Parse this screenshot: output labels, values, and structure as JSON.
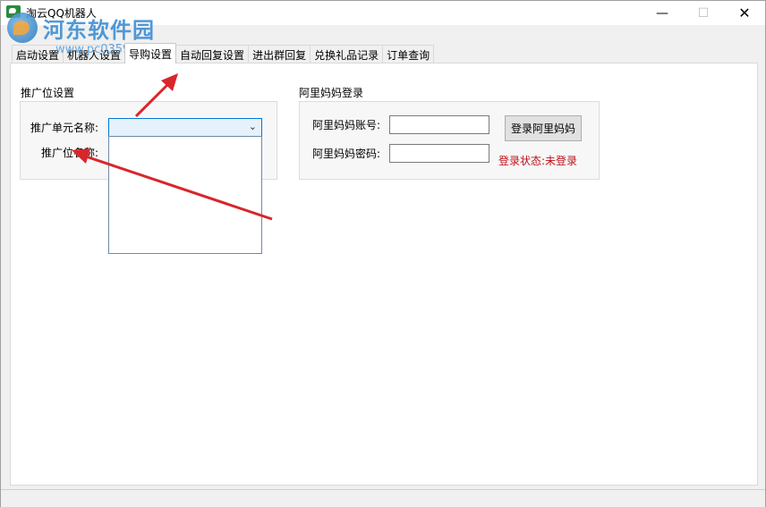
{
  "window": {
    "title": "淘云QQ机器人",
    "minimize_label": "—",
    "maximize_label": "☐",
    "close_label": "✕"
  },
  "watermark": {
    "site_name": "河东软件园",
    "url": "www.pc0359.cn"
  },
  "tabs": [
    {
      "label": "启动设置",
      "active": false
    },
    {
      "label": "机器人设置",
      "active": false
    },
    {
      "label": "导购设置",
      "active": true
    },
    {
      "label": "自动回复设置",
      "active": false
    },
    {
      "label": "进出群回复",
      "active": false
    },
    {
      "label": "兑换礼品记录",
      "active": false
    },
    {
      "label": "订单查询",
      "active": false
    }
  ],
  "promo": {
    "group_title": "推广位设置",
    "unit_label": "推广单元名称:",
    "unit_value": "",
    "position_label": "推广位名称:"
  },
  "alimama": {
    "group_title": "阿里妈妈登录",
    "account_label": "阿里妈妈账号:",
    "account_value": "",
    "password_label": "阿里妈妈密码:",
    "password_value": "",
    "login_button": "登录阿里妈妈",
    "status_text": "登录状态:未登录"
  },
  "colors": {
    "status_red": "#c0101a",
    "arrow_red": "#d8262b",
    "focus_blue": "#0078d7"
  }
}
